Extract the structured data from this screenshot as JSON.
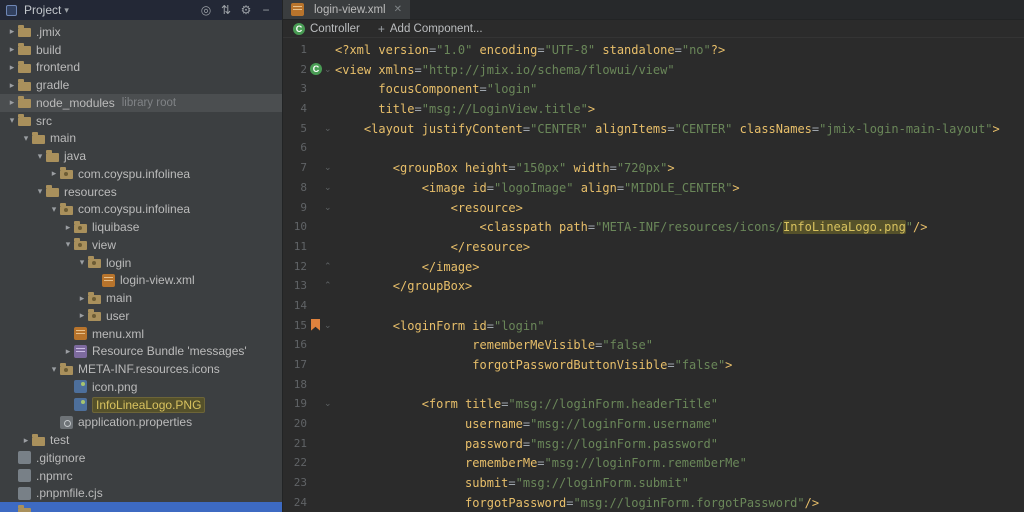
{
  "colors": {
    "editor_bg": "#2b2b2b",
    "panel_bg": "#3c3f41",
    "header_bg": "#232836",
    "tag_gold": "#e8bf6a",
    "string_green": "#6a8759",
    "usage_highlight_bg": "#55512a",
    "usage_highlight_text": "#d8c25f",
    "selection_blue": "#3d6ac2",
    "controller_green": "#499c54",
    "bookmark_orange": "#e0823d"
  },
  "icons": {
    "dropdown": "▾",
    "close": "✕",
    "locate": "◎",
    "collapse": "⇅",
    "settings": "⚙",
    "hide": "−",
    "plus": "+",
    "controller_letter": "C",
    "chevron_collapsed": "▸",
    "chevron_expanded": "▾",
    "fold_down": "⌄",
    "fold_up": "⌃"
  },
  "project": {
    "title": "Project",
    "tree": [
      {
        "label": ".jmix",
        "indent": 0,
        "icon": "folder",
        "chevron": "collapsed"
      },
      {
        "label": "build",
        "indent": 0,
        "icon": "folder",
        "chevron": "collapsed"
      },
      {
        "label": "frontend",
        "indent": 0,
        "icon": "folder",
        "chevron": "collapsed"
      },
      {
        "label": "gradle",
        "indent": 0,
        "icon": "folder",
        "chevron": "collapsed"
      },
      {
        "label": "node_modules",
        "suffix": "library root",
        "indent": 0,
        "icon": "folder",
        "chevron": "collapsed",
        "row": "hover"
      },
      {
        "label": "src",
        "indent": 0,
        "icon": "folder",
        "chevron": "expanded"
      },
      {
        "label": "main",
        "indent": 1,
        "icon": "folder",
        "chevron": "expanded"
      },
      {
        "label": "java",
        "indent": 2,
        "icon": "folder",
        "chevron": "expanded"
      },
      {
        "label": "com.coyspu.infolinea",
        "indent": 3,
        "icon": "package",
        "chevron": "collapsed"
      },
      {
        "label": "resources",
        "indent": 2,
        "icon": "folder",
        "chevron": "expanded"
      },
      {
        "label": "com.coyspu.infolinea",
        "indent": 3,
        "icon": "package",
        "chevron": "expanded"
      },
      {
        "label": "liquibase",
        "indent": 4,
        "icon": "package",
        "chevron": "collapsed"
      },
      {
        "label": "view",
        "indent": 4,
        "icon": "package",
        "chevron": "expanded"
      },
      {
        "label": "login",
        "indent": 5,
        "icon": "package",
        "chevron": "expanded"
      },
      {
        "label": "login-view.xml",
        "indent": 6,
        "icon": "xml"
      },
      {
        "label": "main",
        "indent": 5,
        "icon": "package",
        "chevron": "collapsed"
      },
      {
        "label": "user",
        "indent": 5,
        "icon": "package",
        "chevron": "collapsed"
      },
      {
        "label": "menu.xml",
        "indent": 4,
        "icon": "xml"
      },
      {
        "label": "Resource Bundle 'messages'",
        "indent": 4,
        "icon": "bundle",
        "chevron": "collapsed"
      },
      {
        "label": "META-INF.resources.icons",
        "indent": 3,
        "icon": "package",
        "chevron": "expanded"
      },
      {
        "label": "icon.png",
        "indent": 4,
        "icon": "image"
      },
      {
        "label": "InfoLineaLogo.PNG",
        "indent": 4,
        "icon": "image",
        "row": "match"
      },
      {
        "label": "application.properties",
        "indent": 3,
        "icon": "properties"
      },
      {
        "label": "test",
        "indent": 1,
        "icon": "folder",
        "chevron": "collapsed"
      },
      {
        "label": ".gitignore",
        "indent": 0,
        "icon": "file"
      },
      {
        "label": ".npmrc",
        "indent": 0,
        "icon": "file"
      },
      {
        "label": ".pnpmfile.cjs",
        "indent": 0,
        "icon": "file"
      },
      {
        "label": "",
        "indent": 0,
        "icon": "folder",
        "row": "selected"
      }
    ]
  },
  "editor": {
    "tab": {
      "label": "login-view.xml"
    },
    "toolbar": {
      "controller": "Controller",
      "add_component": "Add Component..."
    },
    "lines": [
      {
        "n": 1,
        "seg": [
          [
            "t",
            "<?xml "
          ],
          [
            "a",
            "version"
          ],
          [
            "p",
            "="
          ],
          [
            "v",
            "\"1.0\""
          ],
          [
            "p",
            " "
          ],
          [
            "a",
            "encoding"
          ],
          [
            "p",
            "="
          ],
          [
            "v",
            "\"UTF-8\""
          ],
          [
            "p",
            " "
          ],
          [
            "a",
            "standalone"
          ],
          [
            "p",
            "="
          ],
          [
            "v",
            "\"no\""
          ],
          [
            "t",
            "?>"
          ]
        ]
      },
      {
        "n": 2,
        "icon": "controller",
        "fold": "down",
        "seg": [
          [
            "t",
            "<view "
          ],
          [
            "a",
            "xmlns"
          ],
          [
            "p",
            "="
          ],
          [
            "v",
            "\"http://jmix.io/schema/flowui/view\""
          ]
        ]
      },
      {
        "n": 3,
        "seg": [
          [
            "p",
            "      "
          ],
          [
            "a",
            "focusComponent"
          ],
          [
            "p",
            "="
          ],
          [
            "v",
            "\"login\""
          ]
        ]
      },
      {
        "n": 4,
        "seg": [
          [
            "p",
            "      "
          ],
          [
            "a",
            "title"
          ],
          [
            "p",
            "="
          ],
          [
            "v",
            "\"msg://LoginView.title\""
          ],
          [
            "t",
            ">"
          ]
        ]
      },
      {
        "n": 5,
        "fold": "down",
        "seg": [
          [
            "p",
            "    "
          ],
          [
            "t",
            "<layout "
          ],
          [
            "a",
            "justifyContent"
          ],
          [
            "p",
            "="
          ],
          [
            "v",
            "\"CENTER\""
          ],
          [
            "p",
            " "
          ],
          [
            "a",
            "alignItems"
          ],
          [
            "p",
            "="
          ],
          [
            "v",
            "\"CENTER\""
          ],
          [
            "p",
            " "
          ],
          [
            "a",
            "classNames"
          ],
          [
            "p",
            "="
          ],
          [
            "v",
            "\"jmix-login-main-layout\""
          ],
          [
            "t",
            ">"
          ]
        ]
      },
      {
        "n": 6,
        "seg": []
      },
      {
        "n": 7,
        "fold": "down",
        "seg": [
          [
            "p",
            "        "
          ],
          [
            "t",
            "<groupBox "
          ],
          [
            "a",
            "height"
          ],
          [
            "p",
            "="
          ],
          [
            "v",
            "\"150px\""
          ],
          [
            "p",
            " "
          ],
          [
            "a",
            "width"
          ],
          [
            "p",
            "="
          ],
          [
            "v",
            "\"720px\""
          ],
          [
            "t",
            ">"
          ]
        ]
      },
      {
        "n": 8,
        "fold": "down",
        "seg": [
          [
            "p",
            "            "
          ],
          [
            "t",
            "<image "
          ],
          [
            "a",
            "id"
          ],
          [
            "p",
            "="
          ],
          [
            "v",
            "\"logoImage\""
          ],
          [
            "p",
            " "
          ],
          [
            "a",
            "align"
          ],
          [
            "p",
            "="
          ],
          [
            "v",
            "\"MIDDLE_CENTER\""
          ],
          [
            "t",
            ">"
          ]
        ]
      },
      {
        "n": 9,
        "fold": "down",
        "seg": [
          [
            "p",
            "                "
          ],
          [
            "t",
            "<resource>"
          ]
        ]
      },
      {
        "n": 10,
        "seg": [
          [
            "p",
            "                    "
          ],
          [
            "t",
            "<classpath "
          ],
          [
            "a",
            "path"
          ],
          [
            "p",
            "="
          ],
          [
            "v",
            "\"META-INF/resources/icons/"
          ],
          [
            "vh",
            "InfoLineaLogo.png"
          ],
          [
            "v",
            "\""
          ],
          [
            "t",
            "/>"
          ]
        ]
      },
      {
        "n": 11,
        "seg": [
          [
            "p",
            "                "
          ],
          [
            "t",
            "</resource>"
          ]
        ]
      },
      {
        "n": 12,
        "fold": "up",
        "seg": [
          [
            "p",
            "            "
          ],
          [
            "t",
            "</image>"
          ]
        ]
      },
      {
        "n": 13,
        "fold": "up",
        "seg": [
          [
            "p",
            "        "
          ],
          [
            "t",
            "</groupBox>"
          ]
        ]
      },
      {
        "n": 14,
        "seg": []
      },
      {
        "n": 15,
        "icon": "bookmark",
        "fold": "down",
        "seg": [
          [
            "p",
            "        "
          ],
          [
            "t",
            "<loginForm "
          ],
          [
            "a",
            "id"
          ],
          [
            "p",
            "="
          ],
          [
            "v",
            "\"login\""
          ]
        ]
      },
      {
        "n": 16,
        "seg": [
          [
            "p",
            "                   "
          ],
          [
            "a",
            "rememberMeVisible"
          ],
          [
            "p",
            "="
          ],
          [
            "v",
            "\"false\""
          ]
        ]
      },
      {
        "n": 17,
        "seg": [
          [
            "p",
            "                   "
          ],
          [
            "a",
            "forgotPasswordButtonVisible"
          ],
          [
            "p",
            "="
          ],
          [
            "v",
            "\"false\""
          ],
          [
            "t",
            ">"
          ]
        ]
      },
      {
        "n": 18,
        "seg": []
      },
      {
        "n": 19,
        "fold": "down",
        "seg": [
          [
            "p",
            "            "
          ],
          [
            "t",
            "<form "
          ],
          [
            "a",
            "title"
          ],
          [
            "p",
            "="
          ],
          [
            "v",
            "\"msg://loginForm.headerTitle\""
          ]
        ]
      },
      {
        "n": 20,
        "seg": [
          [
            "p",
            "                  "
          ],
          [
            "a",
            "username"
          ],
          [
            "p",
            "="
          ],
          [
            "v",
            "\"msg://loginForm.username\""
          ]
        ]
      },
      {
        "n": 21,
        "seg": [
          [
            "p",
            "                  "
          ],
          [
            "a",
            "password"
          ],
          [
            "p",
            "="
          ],
          [
            "v",
            "\"msg://loginForm.password\""
          ]
        ]
      },
      {
        "n": 22,
        "seg": [
          [
            "p",
            "                  "
          ],
          [
            "a",
            "rememberMe"
          ],
          [
            "p",
            "="
          ],
          [
            "v",
            "\"msg://loginForm.rememberMe\""
          ]
        ]
      },
      {
        "n": 23,
        "seg": [
          [
            "p",
            "                  "
          ],
          [
            "a",
            "submit"
          ],
          [
            "p",
            "="
          ],
          [
            "v",
            "\"msg://loginForm.submit\""
          ]
        ]
      },
      {
        "n": 24,
        "seg": [
          [
            "p",
            "                  "
          ],
          [
            "a",
            "forgotPassword"
          ],
          [
            "p",
            "="
          ],
          [
            "v",
            "\"msg://loginForm.forgotPassword\""
          ],
          [
            "t",
            "/>"
          ]
        ]
      }
    ]
  }
}
